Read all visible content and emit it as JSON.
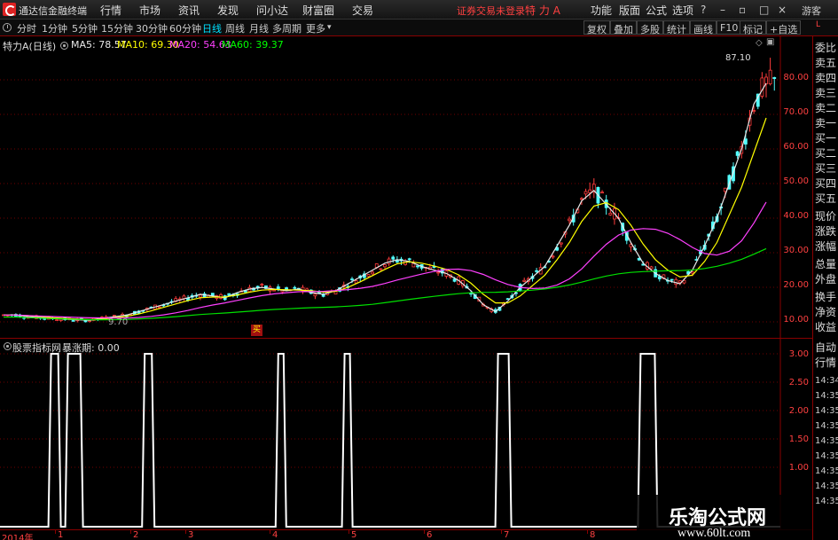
{
  "titlebar": {
    "app_title": "通达信金融终端",
    "menus": [
      "行情",
      "市场",
      "资讯",
      "发现",
      "问小达",
      "财富圈",
      "交易"
    ],
    "login_status": "证券交易未登录",
    "stock_title": "特 力 A",
    "right_menus": [
      "功能",
      "版面",
      "公式",
      "选项"
    ],
    "guest": "游客"
  },
  "toolbar": {
    "periods": [
      "分时",
      "1分钟",
      "5分钟",
      "15分钟",
      "30分钟",
      "60分钟",
      "日线",
      "周线",
      "月线",
      "多周期",
      "更多"
    ],
    "active_period": "日线",
    "right_buttons": [
      "复权",
      "叠加",
      "多股",
      "统计",
      "画线",
      "F10",
      "标记",
      "+自选"
    ]
  },
  "main_chart": {
    "stock_name": "特力A(日线)",
    "ma_legend": [
      {
        "label": "MA5: 78.57",
        "color": "#e8e8e8"
      },
      {
        "label": "MA10: 69.30",
        "color": "#ffff00"
      },
      {
        "label": "MA20: 54.63",
        "color": "#ff40ff"
      },
      {
        "label": "MA60: 39.37",
        "color": "#00ff00"
      }
    ],
    "price_labels": [
      "80.00",
      "70.00",
      "60.00",
      "50.00",
      "40.00",
      "30.00",
      "20.00",
      "10.00"
    ],
    "high_hint": "87.10",
    "low_hint": "9.70",
    "signal_tag": "买"
  },
  "chart_data": {
    "type": "candlestick",
    "ylim": [
      7,
      87
    ],
    "y_ticks": [
      10,
      20,
      30,
      40,
      50,
      60,
      70,
      80
    ],
    "high_marker": 87.1,
    "low_marker": 9.7,
    "ma5": [
      12,
      12,
      11.5,
      11.2,
      11,
      10.8,
      10.6,
      10.5,
      11,
      11.5,
      12,
      13,
      14,
      15,
      16,
      17,
      18,
      17.5,
      17,
      18.5,
      19.5,
      20,
      19.5,
      19,
      19.5,
      18.5,
      18,
      19,
      21,
      23,
      25,
      27,
      28,
      27.5,
      26,
      25,
      24,
      22,
      19,
      15,
      13,
      16,
      20,
      23,
      26,
      32,
      38,
      45,
      48,
      44,
      40,
      33,
      27,
      24,
      22,
      21,
      25,
      32,
      40,
      50,
      60,
      73,
      79
    ],
    "ma10": [
      12,
      12,
      11.8,
      11.5,
      11.2,
      11,
      10.8,
      10.7,
      10.8,
      11.2,
      11.6,
      12.3,
      13.2,
      14.2,
      15.2,
      16.2,
      17,
      17.2,
      17.2,
      17.8,
      18.6,
      19.2,
      19.4,
      19.3,
      19.2,
      19,
      18.6,
      18.8,
      20,
      21.6,
      23.4,
      25.2,
      26.8,
      27.4,
      27,
      26.2,
      25.2,
      23.6,
      21.2,
      18,
      15.5,
      15.5,
      17.5,
      20.5,
      23.5,
      28,
      33,
      39,
      43.5,
      44.5,
      42.5,
      38,
      32.5,
      28,
      25,
      23,
      23.5,
      27.5,
      33,
      41,
      49,
      59,
      69
    ]
  },
  "indicator": {
    "title": "股票指标网",
    "value_label": "暴涨期: 0.00",
    "y_labels": [
      "3.00",
      "2.50",
      "2.00",
      "1.50",
      "1.00"
    ]
  },
  "indicator_data": {
    "type": "line",
    "ylim": [
      0,
      3
    ],
    "pulses": [
      {
        "x": 0.07,
        "value": 3
      },
      {
        "x": 0.095,
        "value": 3
      },
      {
        "x": 0.19,
        "value": 3
      },
      {
        "x": 0.36,
        "value": 3
      },
      {
        "x": 0.445,
        "value": 3
      },
      {
        "x": 0.645,
        "value": 3
      },
      {
        "x": 0.83,
        "value": 3
      }
    ]
  },
  "xaxis": {
    "labels": [
      "2014年",
      "1",
      "2",
      "3",
      "4",
      "5",
      "6",
      "7",
      "8"
    ]
  },
  "rightpanel": {
    "items": [
      "委比",
      "卖五",
      "卖四",
      "卖三",
      "卖二",
      "卖一",
      "买一",
      "买二",
      "买三",
      "买四",
      "买五",
      "现价",
      "涨跌",
      "涨幅",
      "总量",
      "外盘",
      "换手",
      "净资",
      "收益"
    ],
    "bottom_items": [
      "自动",
      "行情"
    ],
    "times": [
      "14:34",
      "14:35",
      "14:35",
      "14:35",
      "14:35",
      "14:35",
      "14:35",
      "14:35",
      "14:35"
    ]
  },
  "watermark": {
    "title": "乐淘公式网",
    "url": "www.60lt.com"
  }
}
